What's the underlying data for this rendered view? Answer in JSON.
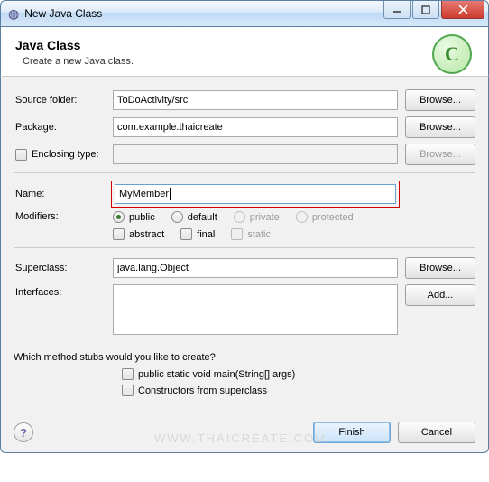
{
  "window": {
    "title": "New Java Class"
  },
  "header": {
    "title": "Java Class",
    "subtitle": "Create a new Java class.",
    "icon_letter": "C"
  },
  "labels": {
    "source_folder": "Source folder:",
    "package": "Package:",
    "enclosing_type": "Enclosing type:",
    "name": "Name:",
    "modifiers": "Modifiers:",
    "superclass": "Superclass:",
    "interfaces": "Interfaces:",
    "stubs_question": "Which method stubs would you like to create?"
  },
  "fields": {
    "source_folder": "ToDoActivity/src",
    "package": "com.example.thaicreate",
    "enclosing_type": "",
    "name": "MyMember",
    "superclass": "java.lang.Object",
    "interfaces": ""
  },
  "modifiers": {
    "public": "public",
    "default": "default",
    "private": "private",
    "protected": "protected",
    "abstract": "abstract",
    "final": "final",
    "static": "static"
  },
  "stubs": {
    "main": "public static void main(String[] args)",
    "constructors": "Constructors from superclass"
  },
  "buttons": {
    "browse": "Browse...",
    "add": "Add...",
    "finish": "Finish",
    "cancel": "Cancel"
  },
  "watermark": "WWW.THAICREATE.COM"
}
